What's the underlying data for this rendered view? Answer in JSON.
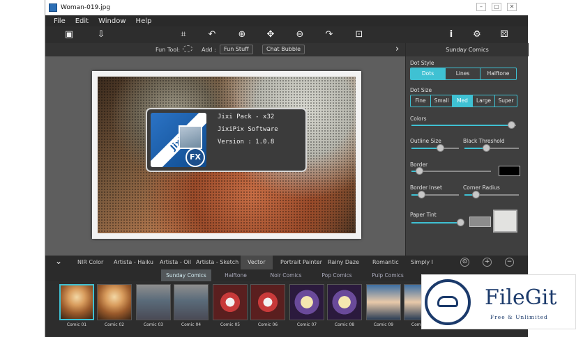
{
  "window": {
    "title": "Woman-019.jpg",
    "controls": [
      "–",
      "▢",
      "✕"
    ]
  },
  "menu": [
    "File",
    "Edit",
    "Window",
    "Help"
  ],
  "toolbar": {
    "icons": [
      "image-icon",
      "save-icon",
      "crop-icon",
      "rotate-left-icon",
      "zoom-in-icon",
      "pan-icon",
      "zoom-out-icon",
      "rotate-right-icon",
      "fit-icon",
      "info-icon",
      "settings-icon",
      "random-icon"
    ],
    "glyphs": [
      "▣",
      "⇩",
      "⌗",
      "↶",
      "⊕",
      "✥",
      "⊖",
      "↷",
      "⊡",
      "i",
      "⚙",
      "⚄"
    ]
  },
  "funbar": {
    "fun_tool_label": "Fun Tool:",
    "add_label": "Add :",
    "fun_stuff": "Fun Stuff",
    "chat_bubble": "Chat Bubble",
    "collapse_glyph": "›"
  },
  "about": {
    "logo_text": "JixiPix",
    "logo_badge": "FX",
    "line1": "Jixi Pack - x32",
    "line2": "JixiPix Software",
    "line3": "Version : 1.0.8"
  },
  "panel": {
    "title": "Sunday Comics",
    "dot_style_label": "Dot Style",
    "dot_styles": [
      "Dots",
      "Lines",
      "Halftone"
    ],
    "dot_style_selected": "Dots",
    "dot_size_label": "Dot Size",
    "dot_sizes": [
      "Fine",
      "Small",
      "Med",
      "Large",
      "Super"
    ],
    "dot_size_selected": "Med",
    "colors_label": "Colors",
    "outline_size_label": "Outline Size",
    "black_threshold_label": "Black Threshold",
    "border_label": "Border",
    "border_inset_label": "Border Inset",
    "corner_radius_label": "Corner Radius",
    "paper_tint_label": "Paper Tint",
    "values": {
      "colors": 0.95,
      "outline_size": 0.6,
      "black_threshold": 0.4,
      "border": 0.1,
      "border_inset": 0.2,
      "corner_radius": 0.2,
      "paper_tint": 0.95
    },
    "border_color": "#000000",
    "tint_color": "#8c8c8c"
  },
  "filter_tabs": {
    "toggle_glyph": "⌄",
    "items": [
      "NIR Color",
      "Artista - Haiku",
      "Artista - Oil",
      "Artista - Sketch",
      "Vector",
      "Portrait Painter",
      "Rainy Daze",
      "Romantic",
      "Simply I"
    ],
    "selected": "Vector",
    "icon_glyphs": [
      "⊙",
      "+",
      "−"
    ]
  },
  "sub_tabs": {
    "items": [
      "Sunday Comics",
      "Halftone",
      "Noir Comics",
      "Pop Comics",
      "Pulp Comics"
    ],
    "selected": "Sunday Comics"
  },
  "thumbnails": [
    "Comic 01",
    "Comic 02",
    "Comic 03",
    "Comic 04",
    "Comic 05",
    "Comic 06",
    "Comic 07",
    "Comic 08",
    "Comic 09",
    "Comic 10"
  ],
  "selected_thumbnail": "Comic 01",
  "watermark": {
    "name": "FileGit",
    "tagline": "Free & Unlimited"
  }
}
